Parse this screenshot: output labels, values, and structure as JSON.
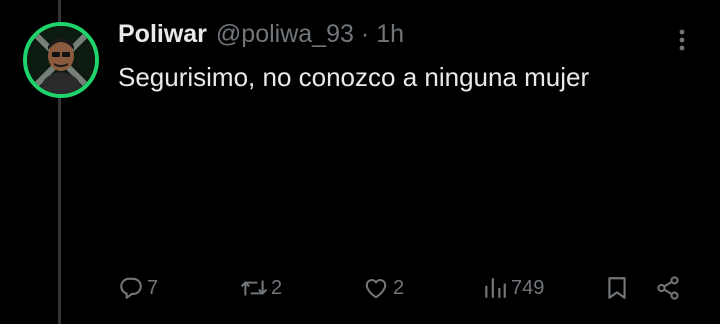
{
  "tweet": {
    "author_name": "Poliwar",
    "handle": "@poliwa_93",
    "separator": "·",
    "time": "1h",
    "text": "Segurisimo, no conozco a ninguna mujer"
  },
  "actions": {
    "replies": "7",
    "retweets": "2",
    "likes": "2",
    "views": "749"
  },
  "icons": {
    "more": "more-options-icon",
    "reply": "reply-icon",
    "retweet": "retweet-icon",
    "like": "heart-icon",
    "views": "views-chart-icon",
    "bookmark": "bookmark-icon",
    "share": "share-icon"
  },
  "colors": {
    "background": "#000000",
    "text_primary": "#e7e9ea",
    "text_secondary": "#71767b",
    "thread_line": "#333639",
    "avatar_ring": "#1fd46b"
  }
}
